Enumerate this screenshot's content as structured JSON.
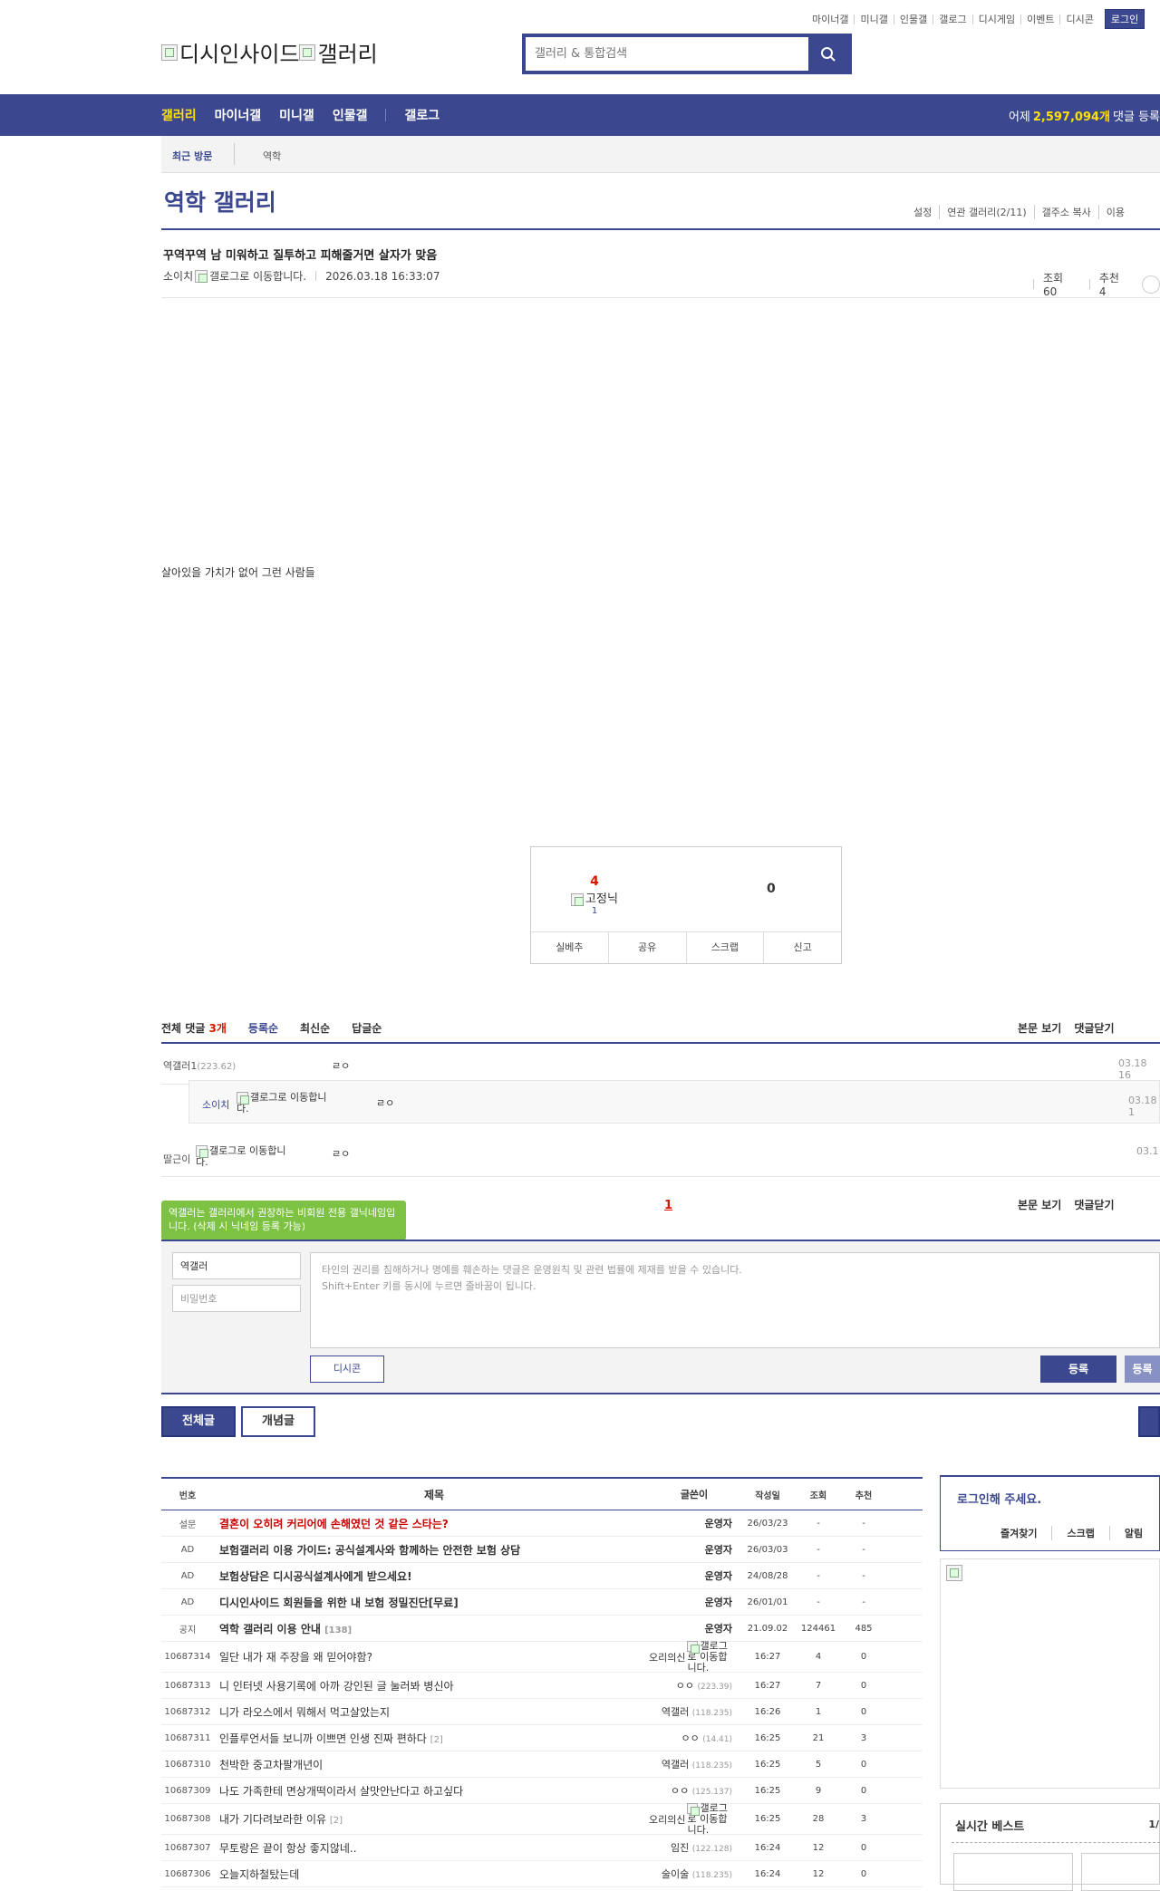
{
  "util_links": [
    "마이너갤",
    "미니갤",
    "인물갤",
    "갤로그",
    "디시게임",
    "이벤트",
    "디시콘"
  ],
  "login": "로그인",
  "logo": {
    "site": "디시인사이드",
    "gallery": "갤러리"
  },
  "search": {
    "placeholder": "갤러리 & 통합검색"
  },
  "gnb": {
    "items": [
      "갤러리",
      "마이너갤",
      "미니갤",
      "인물갤",
      "갤로그"
    ],
    "stat_prefix": "어제",
    "stat_value": "2,597,094개",
    "stat_suffix": "댓글 등록"
  },
  "recent": {
    "label": "최근 방문",
    "item": "역학"
  },
  "gallery": {
    "title": "역학 갤러리",
    "tools": [
      "설정",
      "연관 갤러리(2/11)",
      "갤주소 복사",
      "이용"
    ]
  },
  "post": {
    "title": "꾸역꾸역 남 미워하고 질투하고 피해줄거면 살자가 맞음",
    "author": "소이치",
    "gallog_alt": "갤로그로 이동합니다.",
    "date": "2026.03.18 16:33:07",
    "views": "조회 60",
    "recommend": "추천 4",
    "body": "살아있을 가치가 없어 그런 사람들"
  },
  "recommend_box": {
    "up": "4",
    "fixed_label": "고정닉",
    "fixed_count": "1",
    "down": "0",
    "buttons": [
      "실베추",
      "공유",
      "스크랩",
      "신고"
    ]
  },
  "comments_head": {
    "total_prefix": "전체 댓글",
    "total_count": "3개",
    "sort": [
      "등록순",
      "최신순",
      "답글순"
    ],
    "right": [
      "본문 보기",
      "댓글닫기"
    ]
  },
  "comments": [
    {
      "nick": "역갤러1",
      "ip": "(223.62)",
      "text": "ㄹㅇ",
      "date": "03.18 16"
    },
    {
      "nick": "소이치",
      "gallog_alt": "갤로그로 이동합니다.",
      "text": "ㄹㅇ",
      "date": "03.18 1"
    },
    {
      "nick": "딸근이",
      "gallog_alt": "갤로그로 이동합니다.",
      "text": "ㄹㅇ",
      "date": "03.1"
    }
  ],
  "comment_page": "1",
  "tooltip": "역갤러는 갤러리에서 권장하는 비회원 전용 갤닉네임입니다. (삭제 시 닉네임 등록 가능)",
  "write": {
    "nick": "역갤러",
    "pw_placeholder": "비밀번호",
    "memo_line1": "타인의 권리를 침해하거나 명예를 훼손하는 댓글은 운영원칙 및 관련 법률에 제재를 받을 수 있습니다.",
    "memo_line2": "Shift+Enter 키를 동시에 누르면 줄바꿈이 됩니다.",
    "dccon": "디시콘",
    "submit": "등록",
    "submit2": "등록"
  },
  "tabs": {
    "all": "전체글",
    "concept": "개념글"
  },
  "list": {
    "headers": [
      "번호",
      "제목",
      "글쓴이",
      "작성일",
      "조회",
      "추천"
    ],
    "rows": [
      {
        "no": "설문",
        "title": "결혼이 오히려 커리어에 손해였던 것 같은 스타는?",
        "writer": "운영자",
        "date": "26/03/23",
        "views": "-",
        "rec": "-",
        "kind": "survey"
      },
      {
        "no": "AD",
        "title": "보험갤러리 이용 가이드: 공식설계사와 함께하는 안전한 보험 상담",
        "writer": "운영자",
        "date": "26/03/03",
        "views": "-",
        "rec": "-",
        "kind": "notice"
      },
      {
        "no": "AD",
        "title": "보험상담은 디시공식설계사에게 받으세요!",
        "writer": "운영자",
        "date": "24/08/28",
        "views": "-",
        "rec": "-",
        "kind": "notice"
      },
      {
        "no": "AD",
        "title": "디시인사이드 회원들을 위한 내 보험 정밀진단[무료]",
        "writer": "운영자",
        "date": "26/01/01",
        "views": "-",
        "rec": "-",
        "kind": "notice"
      },
      {
        "no": "공지",
        "title": "역학 갤러리 이용 안내",
        "rc": "[138]",
        "writer": "운영자",
        "date": "21.09.02",
        "views": "124461",
        "rec": "485",
        "kind": "notice"
      },
      {
        "no": "10687314",
        "title": "일단 내가 재 주장을 왜 믿어야함?",
        "writer": "오리의신",
        "gallog": true,
        "date": "16:27",
        "views": "4",
        "rec": "0"
      },
      {
        "no": "10687313",
        "title": "니 인터넷 사용기록에 아까 강인된 글 눌러봐 병신아",
        "writer": "ㅇㅇ",
        "ip": "(223.39)",
        "date": "16:27",
        "views": "7",
        "rec": "0"
      },
      {
        "no": "10687312",
        "title": "니가 라오스에서 뭐해서 먹고살았는지",
        "writer": "역갤러",
        "ip": "(118.235)",
        "date": "16:26",
        "views": "1",
        "rec": "0"
      },
      {
        "no": "10687311",
        "title": "인플루언서들 보니까 이쁘면 인생 진짜 편하다",
        "rc": "[2]",
        "writer": "ㅇㅇ",
        "ip": "(14.41)",
        "date": "16:25",
        "views": "21",
        "rec": "3"
      },
      {
        "no": "10687310",
        "title": "천박한 중고차팔개년이",
        "writer": "역갤러",
        "ip": "(118.235)",
        "date": "16:25",
        "views": "5",
        "rec": "0"
      },
      {
        "no": "10687309",
        "title": "나도 가족한테 면상개떡이라서 살맛안난다고 하고싶다",
        "writer": "ㅇㅇ",
        "ip": "(125.137)",
        "date": "16:25",
        "views": "9",
        "rec": "0"
      },
      {
        "no": "10687308",
        "title": "내가 기다려보라한 이유",
        "rc": "[2]",
        "writer": "오리의신",
        "gallog": true,
        "date": "16:25",
        "views": "28",
        "rec": "3"
      },
      {
        "no": "10687307",
        "title": "무토랑은 끝이 항상 좋지않네..",
        "writer": "임진",
        "ip": "(122.128)",
        "date": "16:24",
        "views": "12",
        "rec": "0"
      },
      {
        "no": "10687306",
        "title": "오늘지하철탔는데",
        "writer": "술이술",
        "ip": "(118.235)",
        "date": "16:24",
        "views": "12",
        "rec": "0"
      }
    ]
  },
  "side": {
    "login_title": "로그인해 주세요.",
    "links": [
      "즐겨찾기",
      "스크랩",
      "알림"
    ],
    "best_title": "실시간 베스트",
    "best_page": "1/"
  },
  "colors": {
    "brand": "#3b4890",
    "accent": "#ffe100",
    "red": "#d31900",
    "tooltip": "#7dc242"
  }
}
